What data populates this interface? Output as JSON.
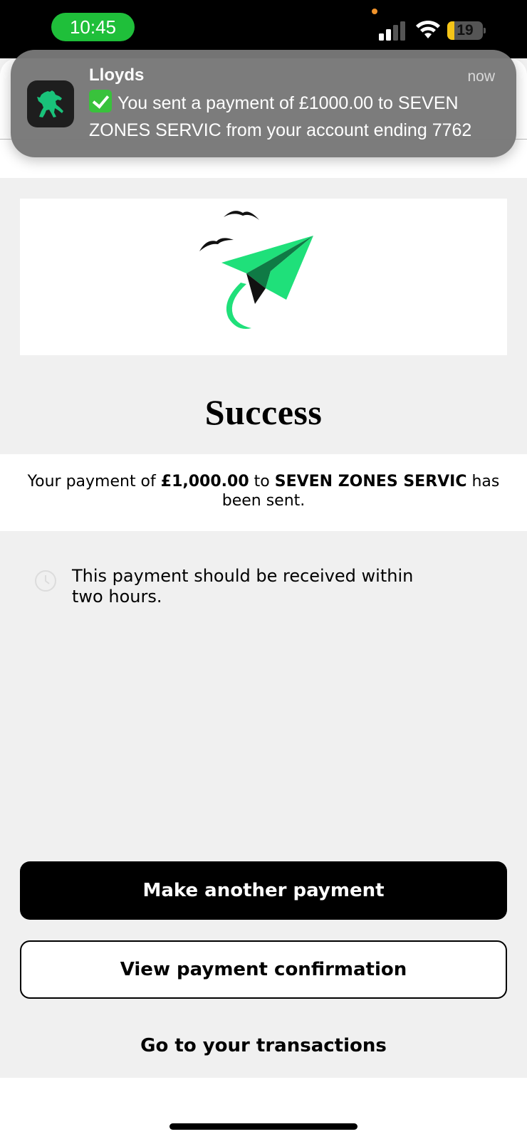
{
  "status_bar": {
    "time": "10:45",
    "battery_level": "19",
    "battery_fraction": 0.19,
    "signal_icon": "cellular-signal-icon",
    "wifi_icon": "wifi-icon"
  },
  "notification": {
    "app_name": "Lloyds",
    "time": "now",
    "message": "You sent a payment of £1000.00 to SEVEN ZONES SERVIC from your account ending 7762",
    "app_icon": "lloyds-horse-icon",
    "emoji": "check-mark-icon"
  },
  "illustration": {
    "icon": "paper-plane-icon",
    "accent_color": "#1fe07a"
  },
  "success": {
    "title": "Success"
  },
  "message": {
    "prefix": "Your payment of ",
    "amount": "£1,000.00",
    "middle": " to ",
    "payee": "SEVEN ZONES SERVIC",
    "suffix": " has been sent."
  },
  "info": {
    "icon": "clock-icon",
    "text": "This payment should be received within two hours."
  },
  "actions": {
    "primary": "Make another payment",
    "secondary": "View payment confirmation",
    "link": "Go to your transactions"
  }
}
